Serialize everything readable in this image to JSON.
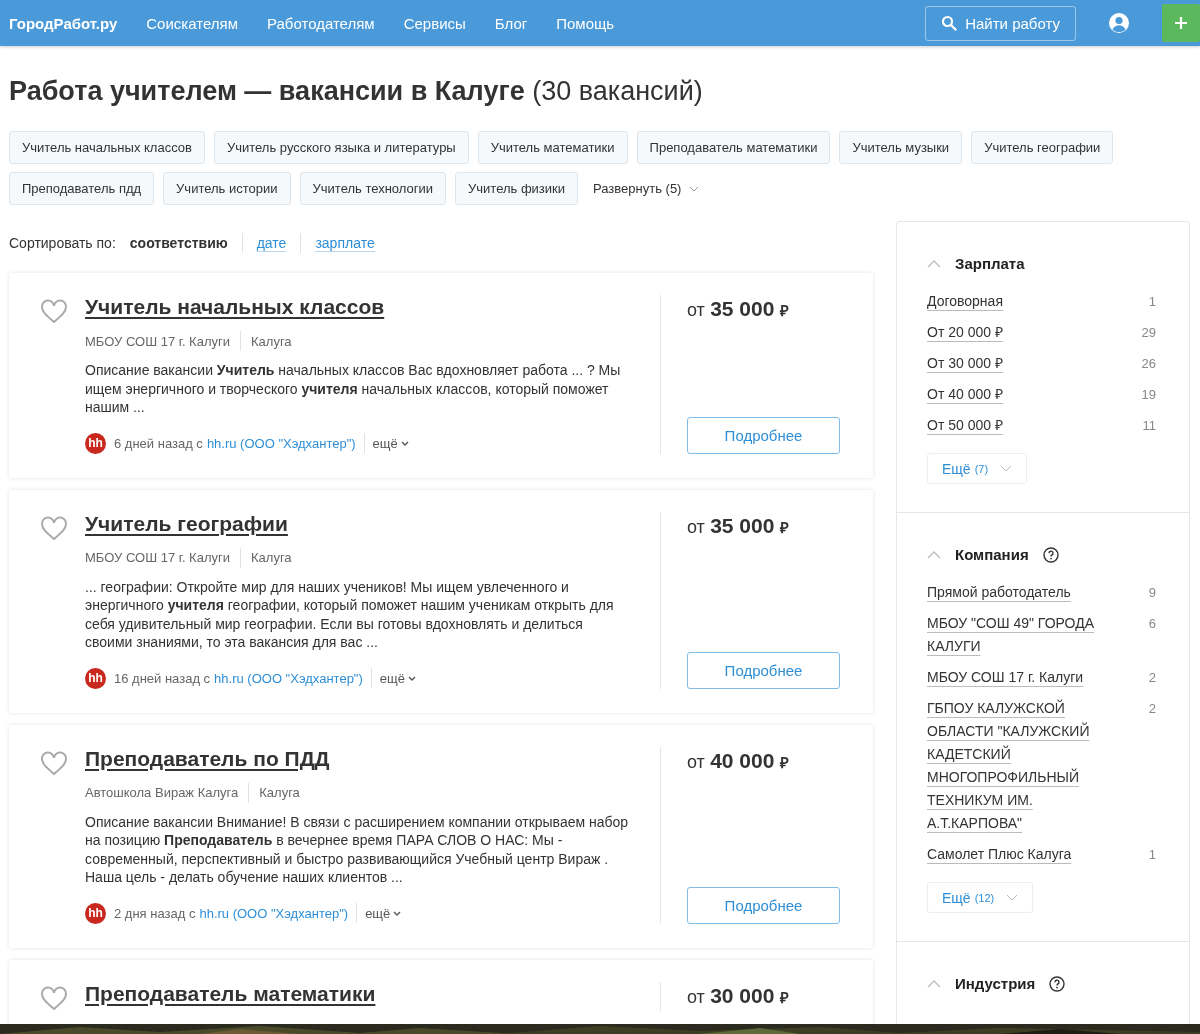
{
  "header": {
    "logo": "ГородРабот.ру",
    "nav": [
      "Соискателям",
      "Работодателям",
      "Сервисы",
      "Блог",
      "Помощь"
    ],
    "search_button": "Найти работу"
  },
  "page_title": "Работа учителем — вакансии в Калуге",
  "vacancy_count": "(30 вакансий)",
  "tags": [
    "Учитель начальных классов",
    "Учитель русского языка и литературы",
    "Учитель математики",
    "Преподаватель математики",
    "Учитель музыки",
    "Учитель географии",
    "Преподаватель пдд",
    "Учитель истории",
    "Учитель технологии",
    "Учитель физики"
  ],
  "expand_tags": "Развернуть (5)",
  "sort": {
    "label": "Сортировать по:",
    "options": [
      {
        "label": "соответствию",
        "selected": true
      },
      {
        "label": "дате",
        "selected": false
      },
      {
        "label": "зарплате",
        "selected": false
      }
    ]
  },
  "vacancies": [
    {
      "title": "Учитель начальных классов",
      "company": "МБОУ СОШ 17 г. Калуги",
      "city": "Калуга",
      "description": "Описание вакансии **Учитель** начальных классов Вас вдохновляет работа ... ? Мы ищем энергичного и творческого **учителя** начальных классов, который поможет нашим ...",
      "source_logo": "hh",
      "posted": "6 дней назад с",
      "source": "hh.ru (ООО \"Хэдхантер\")",
      "more": "ещё",
      "salary_prefix": "от",
      "salary": "35 000",
      "currency": "₽",
      "details_button": "Подробнее"
    },
    {
      "title": "Учитель географии",
      "company": "МБОУ СОШ 17 г. Калуги",
      "city": "Калуга",
      "description": "... географии: Откройте мир для наших учеников! Мы ищем увлеченного и энергичного **учителя** географии, который поможет нашим ученикам открыть для себя удивительный мир географии. Если вы готовы вдохновлять и делиться своими знаниями, то эта вакансия для вас ...",
      "source_logo": "hh",
      "posted": "16 дней назад с",
      "source": "hh.ru (ООО \"Хэдхантер\")",
      "more": "ещё",
      "salary_prefix": "от",
      "salary": "35 000",
      "currency": "₽",
      "details_button": "Подробнее"
    },
    {
      "title": "Преподаватель по ПДД",
      "company": "Автошкола Вираж Калуга",
      "city": "Калуга",
      "description": "Описание вакансии Внимание! В связи с расширением компании открываем набор на позицию **Преподаватель** в вечернее время ПАРА СЛОВ О НАС: Мы - современный, перспективный и быстро развивающийся Учебный центр Вираж . Наша цель - делать обучение наших клиентов ...",
      "source_logo": "hh",
      "posted": "2 дня назад с",
      "source": "hh.ru (ООО \"Хэдхантер\")",
      "more": "ещё",
      "salary_prefix": "от",
      "salary": "40 000",
      "currency": "₽",
      "details_button": "Подробнее"
    },
    {
      "title": "Преподаватель математики",
      "salary_prefix": "от",
      "salary": "30 000",
      "currency": "₽"
    }
  ],
  "filters": [
    {
      "title": "Зарплата",
      "expanded": true,
      "help": false,
      "items": [
        {
          "label": "Договорная",
          "count": "1"
        },
        {
          "label": "От 20 000 ₽",
          "count": "29"
        },
        {
          "label": "От 30 000 ₽",
          "count": "26"
        },
        {
          "label": "От 40 000 ₽",
          "count": "19"
        },
        {
          "label": "От 50 000 ₽",
          "count": "11"
        }
      ],
      "more": "Ещё",
      "more_count": "(7)"
    },
    {
      "title": "Компания",
      "expanded": true,
      "help": true,
      "items": [
        {
          "label": "Прямой работодатель",
          "count": "9"
        },
        {
          "label": "МБОУ \"СОШ 49\" ГОРОДА КАЛУГИ",
          "count": "6"
        },
        {
          "label": "МБОУ СОШ 17 г. Калуги",
          "count": "2"
        },
        {
          "label": "ГБПОУ КАЛУЖСКОЙ ОБЛАСТИ \"КАЛУЖСКИЙ КАДЕТСКИЙ МНОГОПРОФИЛЬНЫЙ ТЕХНИКУМ ИМ. А.Т.КАРПОВА\"",
          "count": "2"
        },
        {
          "label": "Самолет Плюс Калуга",
          "count": "1"
        }
      ],
      "more": "Ещё",
      "more_count": "(12)"
    },
    {
      "title": "Индустрия",
      "expanded": true,
      "help": true
    }
  ]
}
